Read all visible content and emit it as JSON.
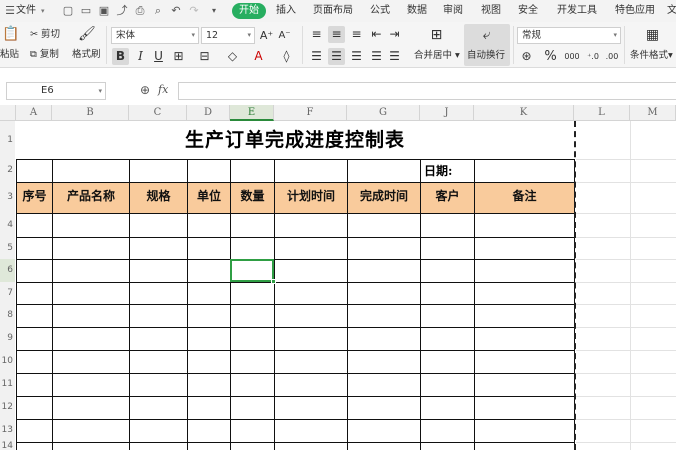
{
  "menubar": {
    "file_label": "文件",
    "tabs": [
      "开始",
      "插入",
      "页面布局",
      "公式",
      "数据",
      "审阅",
      "视图",
      "安全",
      "开发工具",
      "特色应用",
      "文"
    ],
    "active_tab": "开始"
  },
  "ribbon": {
    "paste": "粘贴",
    "cut": "剪切",
    "copy": "复制",
    "format_painter": "格式刷",
    "font_name": "宋体",
    "font_size": "12",
    "merge_center": "合并居中",
    "auto_wrap": "自动换行",
    "number_format": "常规",
    "percent": "%",
    "thousands": "000",
    "cond_format": "条件格式"
  },
  "formula_bar": {
    "name_box": "E6",
    "fx": "fx"
  },
  "columns": [
    "A",
    "B",
    "C",
    "D",
    "E",
    "F",
    "G",
    "J",
    "K",
    "L",
    "M"
  ],
  "selected_column": "E",
  "rows": [
    "1",
    "2",
    "3",
    "4",
    "5",
    "6",
    "7",
    "8",
    "9",
    "10",
    "11",
    "12",
    "13",
    "14"
  ],
  "selected_row": "6",
  "sheet": {
    "title": "生产订单完成进度控制表",
    "date_label": "日期:",
    "headers": [
      "序号",
      "产品名称",
      "规格",
      "单位",
      "数量",
      "计划时间",
      "完成时间",
      "客户",
      "备注"
    ]
  },
  "colors": {
    "header_fill": "#f9cb9c",
    "accent_green": "#27ae60",
    "selection_green": "#2f9e44"
  }
}
